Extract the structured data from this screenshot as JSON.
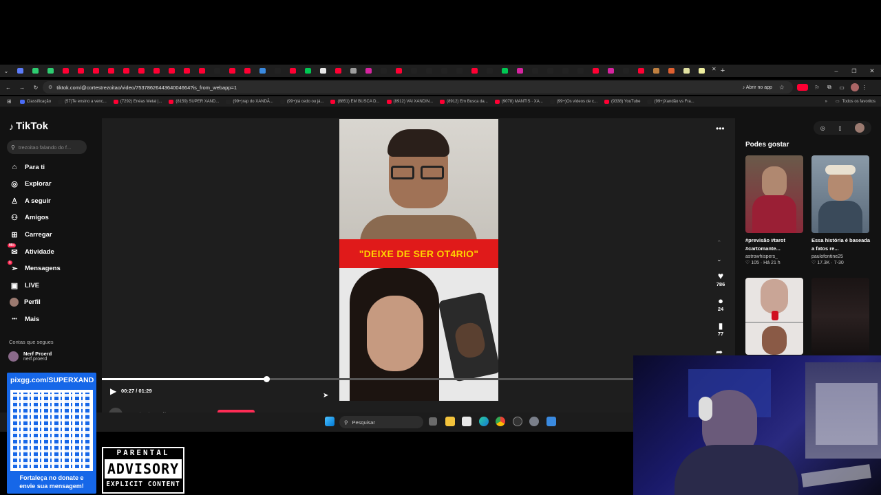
{
  "browser": {
    "url": "tiktok.com/@cortestrezoitao/video/7537862644364004664?is_from_webapp=1",
    "open_in_app": "Abrir no app",
    "all_bookmarks": "Todos os favoritos",
    "bookmarks": [
      {
        "label": "Classificação",
        "color": "#4a6cf7"
      },
      {
        "label": "(57)Te ensino a venc...",
        "color": "#222"
      },
      {
        "label": "(7292) Enéas Metal |...",
        "color": "#ff0033"
      },
      {
        "label": "(8159) SUPER XAND...",
        "color": "#ff0033"
      },
      {
        "label": "(99+)rap do XANDÃ...",
        "color": "#222"
      },
      {
        "label": "(99+)tá cedo ou já...",
        "color": "#222"
      },
      {
        "label": "(8851) EM BUSCA D...",
        "color": "#ff0033"
      },
      {
        "label": "(8912) VAI XANDIN...",
        "color": "#ff0033"
      },
      {
        "label": "(8912) Em Busca da...",
        "color": "#ff0033"
      },
      {
        "label": "(9078) MANTIS · XA...",
        "color": "#ff0033"
      },
      {
        "label": "(99+)Os vídeos de c...",
        "color": "#222"
      },
      {
        "label": "(9338) YouTube",
        "color": "#ff0033"
      },
      {
        "label": "(99+)Xandão vs Fra...",
        "color": "#222"
      }
    ]
  },
  "tiktok": {
    "logo": "TikTok",
    "search_placeholder": "trezoitao falando do f...",
    "nav": [
      {
        "label": "Para ti",
        "icon": "home-icon"
      },
      {
        "label": "Explorar",
        "icon": "compass-icon"
      },
      {
        "label": "A seguir",
        "icon": "user-follow-icon"
      },
      {
        "label": "Amigos",
        "icon": "friends-icon"
      },
      {
        "label": "Carregar",
        "icon": "upload-icon"
      },
      {
        "label": "Atividade",
        "icon": "activity-icon",
        "badge": "99+"
      },
      {
        "label": "Mensagens",
        "icon": "messages-icon",
        "badge": "1"
      },
      {
        "label": "LIVE",
        "icon": "live-icon"
      },
      {
        "label": "Perfil",
        "icon": "profile-icon"
      },
      {
        "label": "Mais",
        "icon": "more-icon"
      }
    ],
    "following_title": "Contas que segues",
    "following_account": {
      "name": "Nerf Proerd",
      "handle": "nerf.proerd"
    },
    "video_caption": "\"DEIXE DE SER OT4RIO\"",
    "time": "00:27 / 01:29",
    "progress": 0.31,
    "author": "cortestrezoitao",
    "actions": {
      "likes": "786",
      "comments": "24",
      "saves": "77"
    },
    "suggested_title": "Podes gostar",
    "suggested": [
      {
        "title": "#previsão #tarot #cartomante...",
        "author": "astrowhispers_",
        "likes": "105",
        "age": "Há 21 h"
      },
      {
        "title": "Essa história é baseada a fatos re...",
        "author": "paulofontine25",
        "likes": "17.3K",
        "age": "7-30"
      }
    ]
  },
  "taskbar": {
    "search_placeholder": "Pesquisar"
  },
  "overlay": {
    "donate_url": "pixgg.com/SUPERXAND",
    "donate_text": "Fortaleça no donate e envie sua mensagem!",
    "advisory": {
      "top": "PARENTAL",
      "middle": "ADVISORY",
      "bottom": "EXPLICIT CONTENT"
    }
  },
  "colors": {
    "accent": "#fe2c55",
    "video_banner": "#e01a1a",
    "caption_text": "#ffd200"
  }
}
